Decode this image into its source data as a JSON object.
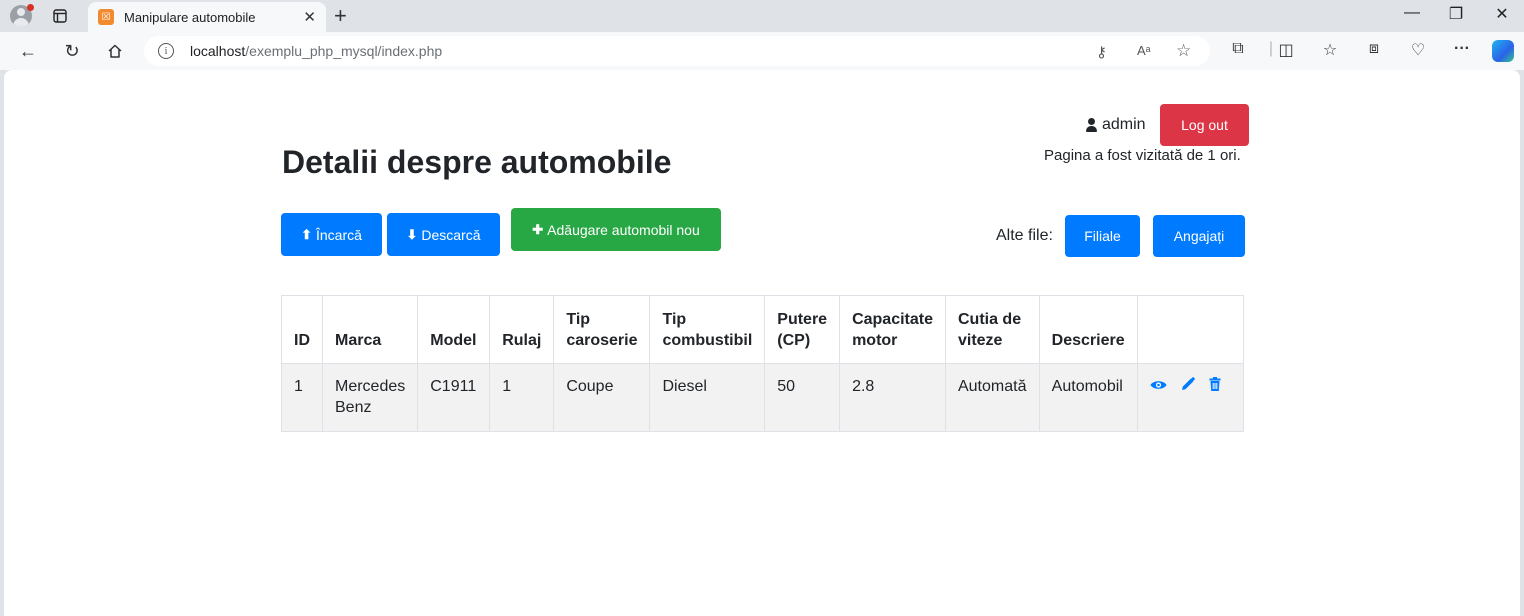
{
  "browser": {
    "tab_title": "Manipulare automobile",
    "url_host": "localhost",
    "url_path": "/exemplu_php_mysql/index.php"
  },
  "user": {
    "username": "admin",
    "logout_label": "Log out",
    "visits_text": "Pagina a fost vizitată de 1 ori."
  },
  "page": {
    "title": "Detalii despre automobile"
  },
  "actions": {
    "upload_label": "Încarcă",
    "download_label": "Descarcă",
    "add_label": "Adăugare automobil nou",
    "other_files_label": "Alte file:",
    "branches_label": "Filiale",
    "employees_label": "Angajați"
  },
  "table": {
    "headers": [
      "ID",
      "Marca",
      "Model",
      "Rulaj",
      "Tip caroserie",
      "Tip combustibil",
      "Putere (CP)",
      "Capacitate motor",
      "Cutia de viteze",
      "Descriere",
      ""
    ],
    "rows": [
      [
        "1",
        "Mercedes Benz",
        "C1911",
        "1",
        "Coupe",
        "Diesel",
        "50",
        "2.8",
        "Automată",
        "Automobil"
      ]
    ]
  },
  "colors": {
    "primary": "#007bff",
    "danger": "#dc3545",
    "success": "#28a745"
  },
  "icons": {
    "view": "eye-icon",
    "edit": "pencil-icon",
    "delete": "trash-icon",
    "upload": "upload-icon",
    "download": "download-icon",
    "add": "plus-icon",
    "user": "user-icon"
  }
}
